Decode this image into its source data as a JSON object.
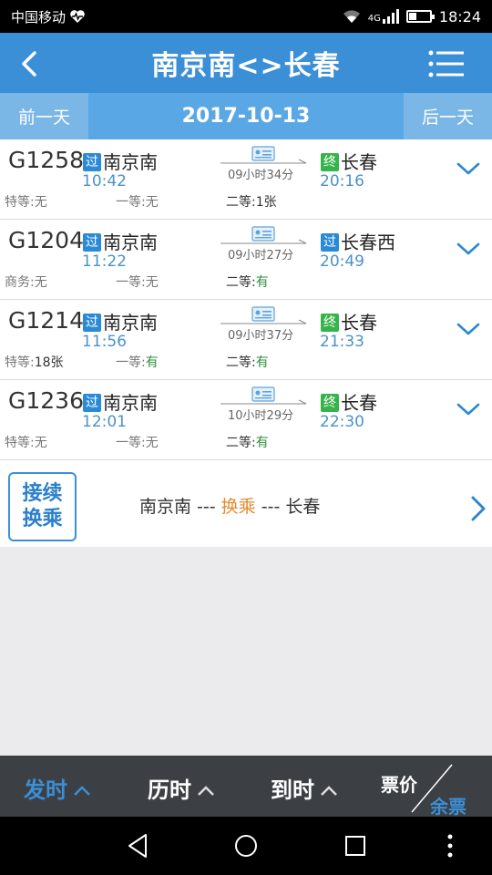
{
  "status_bar": {
    "carrier": "中国移动",
    "network": "4G",
    "time": "18:24"
  },
  "header": {
    "title": "南京南<>长春"
  },
  "date_bar": {
    "prev": "前一天",
    "date": "2017-10-13",
    "next": "后一天"
  },
  "trains": [
    {
      "code": "G1258",
      "from_tag": "过",
      "from": "南京南",
      "dep": "10:42",
      "duration": "09小时34分",
      "to_tag": "终",
      "to": "长春",
      "arr": "20:16",
      "seats": [
        {
          "label": "特等:",
          "value": "无"
        },
        {
          "label": "一等:",
          "value": "无"
        },
        {
          "label": "二等:",
          "value": "1张"
        }
      ]
    },
    {
      "code": "G1204",
      "from_tag": "过",
      "from": "南京南",
      "dep": "11:22",
      "duration": "09小时27分",
      "to_tag": "过",
      "to": "长春西",
      "arr": "20:49",
      "seats": [
        {
          "label": "商务:",
          "value": "无"
        },
        {
          "label": "一等:",
          "value": "无"
        },
        {
          "label": "二等:",
          "value": "有"
        }
      ]
    },
    {
      "code": "G1214",
      "from_tag": "过",
      "from": "南京南",
      "dep": "11:56",
      "duration": "09小时37分",
      "to_tag": "终",
      "to": "长春",
      "arr": "21:33",
      "seats": [
        {
          "label": "特等:",
          "value": "18张"
        },
        {
          "label": "一等:",
          "value": "有"
        },
        {
          "label": "二等:",
          "value": "有"
        }
      ]
    },
    {
      "code": "G1236",
      "from_tag": "过",
      "from": "南京南",
      "dep": "12:01",
      "duration": "10小时29分",
      "to_tag": "终",
      "to": "长春",
      "arr": "22:30",
      "seats": [
        {
          "label": "特等:",
          "value": "无"
        },
        {
          "label": "一等:",
          "value": "无"
        },
        {
          "label": "二等:",
          "value": "有"
        }
      ]
    }
  ],
  "transfer": {
    "badge_line1": "接续",
    "badge_line2": "换乘",
    "from": "南京南",
    "sep1": " --- ",
    "mid": "换乘",
    "sep2": " --- ",
    "to": "长春"
  },
  "sort_bar": {
    "depart": "发时",
    "duration": "历时",
    "arrive": "到时",
    "price": "票价",
    "remain": "余票"
  },
  "colors": {
    "primary": "#3b8fd6",
    "available": "#2e8f3a",
    "transfer_accent": "#e7892f",
    "end_tag": "#36b34a"
  }
}
